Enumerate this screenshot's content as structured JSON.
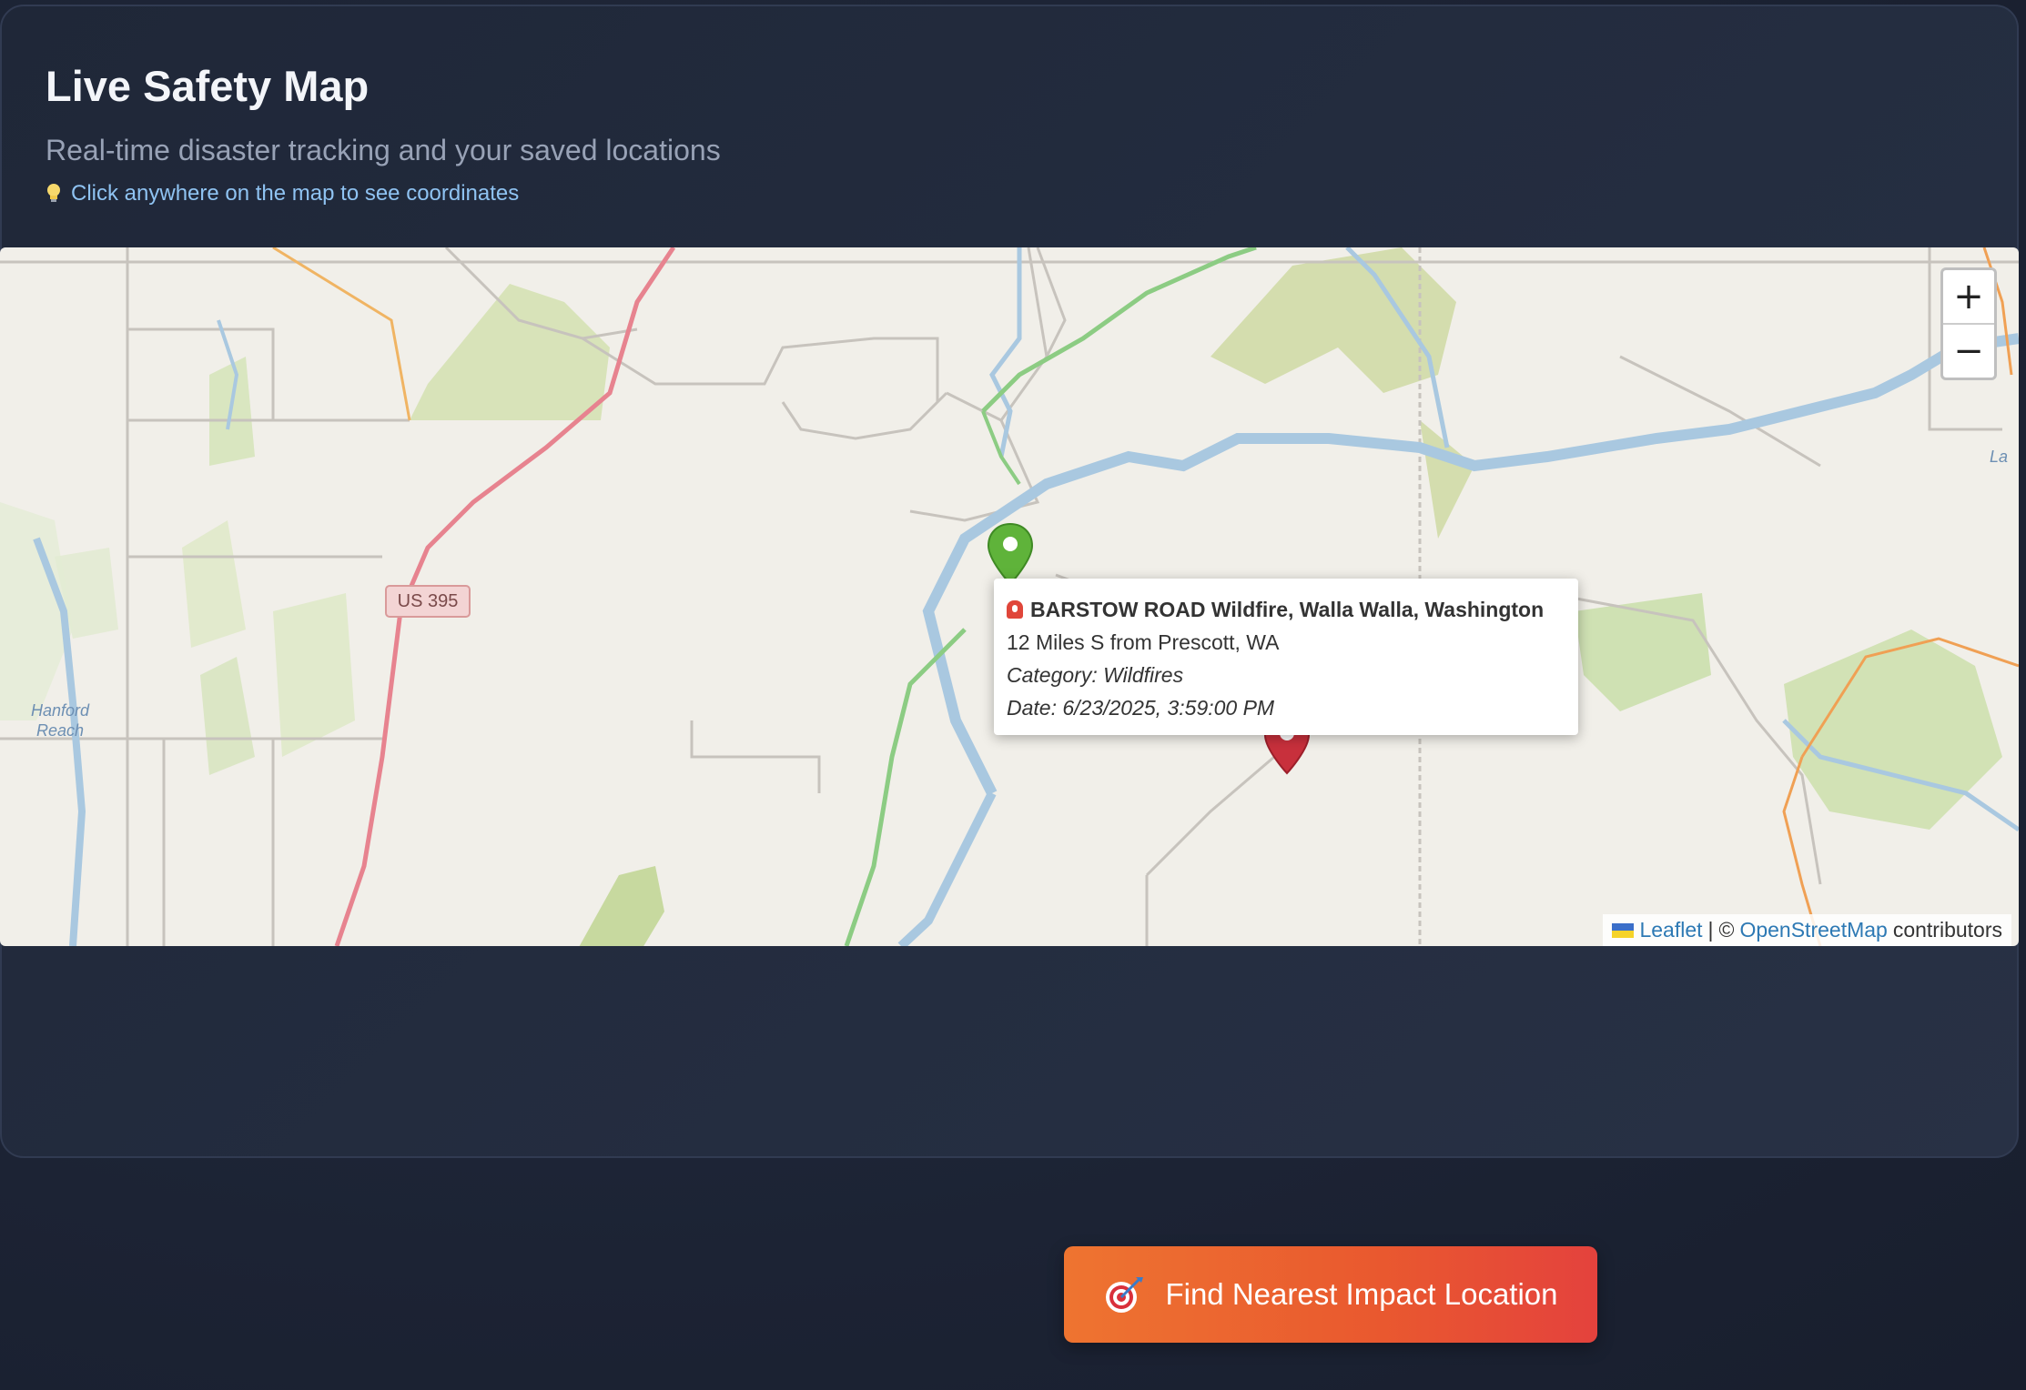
{
  "header": {
    "title": "Live Safety Map",
    "subtitle": "Real-time disaster tracking and your saved locations",
    "hint": "Click anywhere on the map to see coordinates"
  },
  "map": {
    "road_shield": "US 395",
    "place_label": "Hanford Reach",
    "place_label_line1": "Hanford",
    "place_label_line2": "Reach",
    "edge_label": "La",
    "zoom_in": "+",
    "zoom_out": "−",
    "attribution": {
      "leaflet": "Leaflet",
      "separator": "|",
      "copyright": "©",
      "osm": "OpenStreetMap",
      "contributors": "contributors"
    },
    "markers": [
      {
        "kind": "saved-location",
        "color": "#5fb33a"
      },
      {
        "kind": "disaster",
        "color": "#c8303c"
      }
    ]
  },
  "popup": {
    "title": "BARSTOW ROAD Wildfire, Walla Walla, Washington",
    "location": "12 Miles S from Prescott, WA",
    "category": "Category: Wildfires",
    "date": "Date: 6/23/2025, 3:59:00 PM"
  },
  "actions": {
    "find_nearest": "Find Nearest Impact Location"
  },
  "colors": {
    "page_bg": "#1b2233",
    "accent_orange": "#ee7430",
    "accent_red": "#e4423d",
    "hint_blue": "#8fc3f2",
    "link_blue": "#2d79b4"
  }
}
